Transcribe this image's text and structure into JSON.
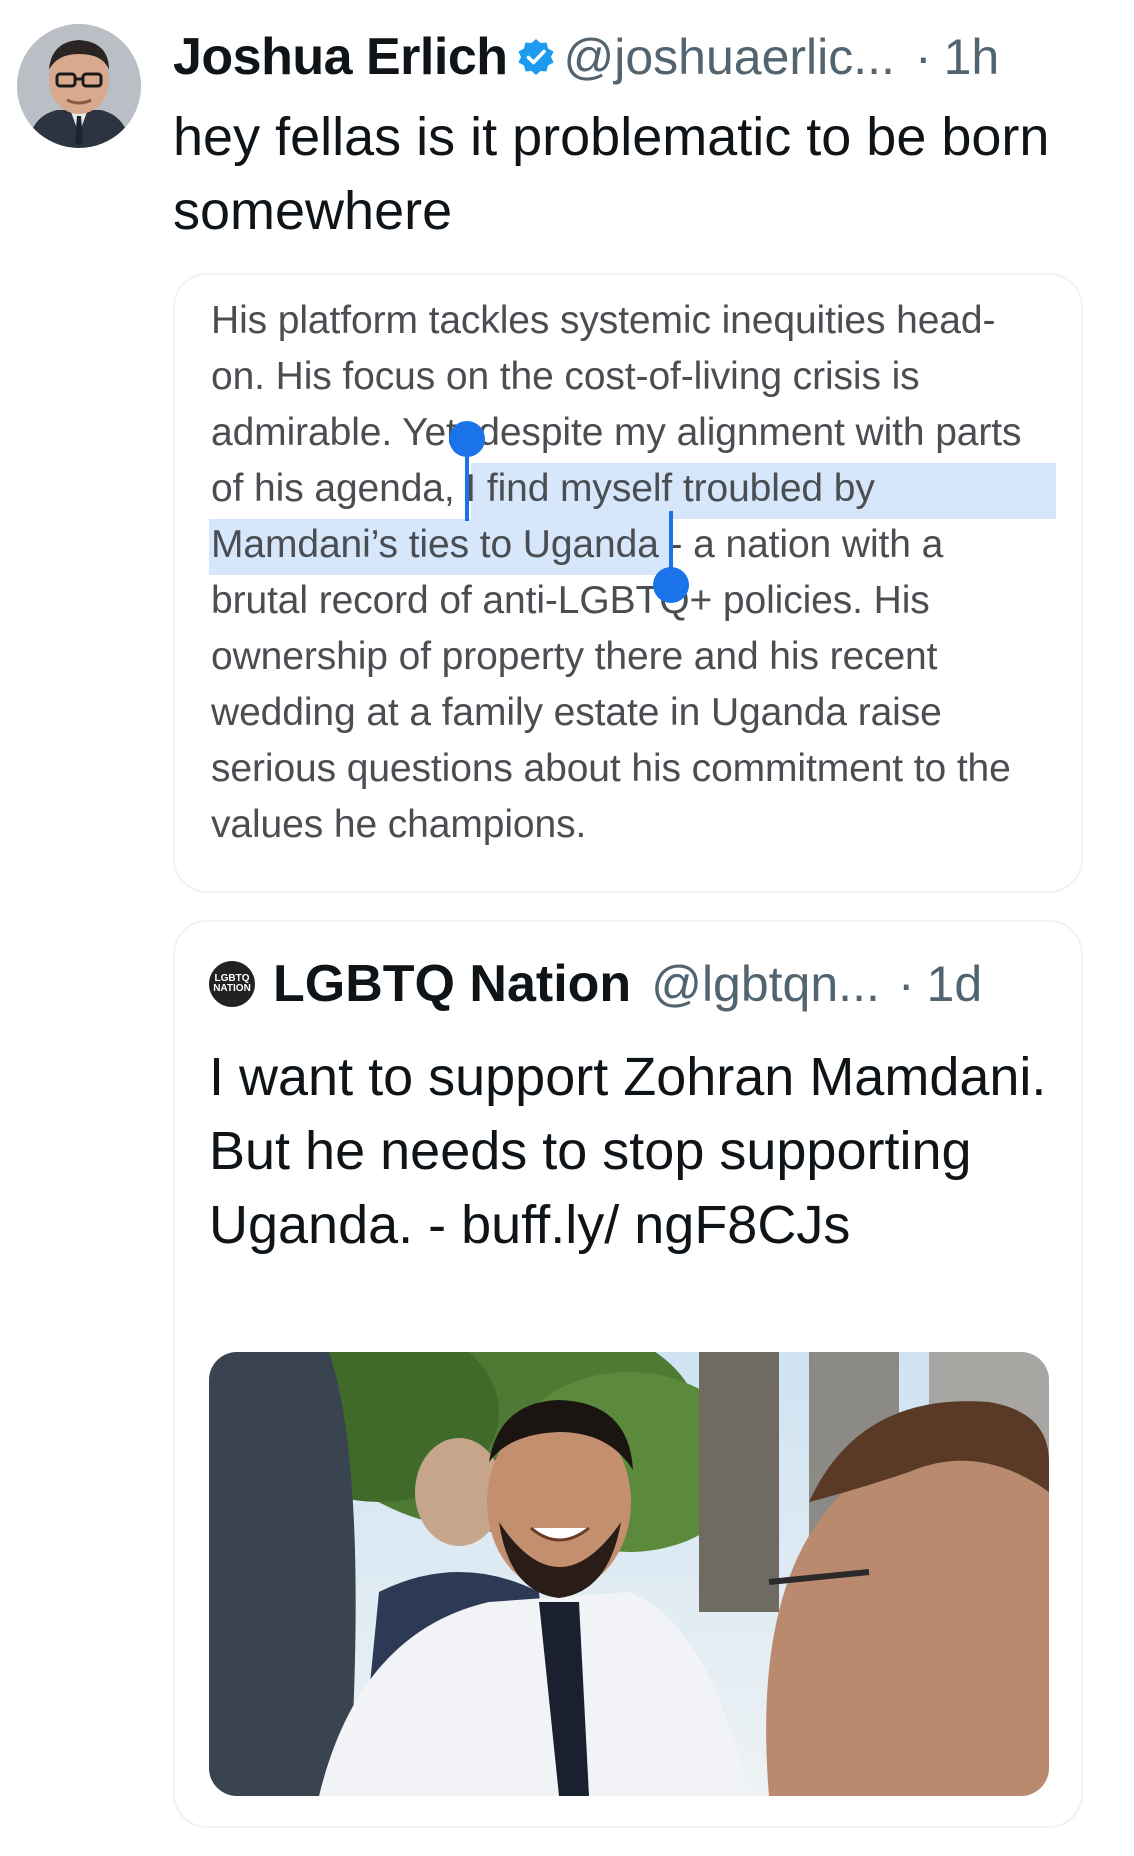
{
  "tweet": {
    "author_name": "Joshua Erlich",
    "author_handle": "@joshuaerlic...",
    "separator": "·",
    "timestamp": "1h",
    "verified_icon": "verified-badge-icon",
    "text": "hey fellas is it problematic to be born somewhere"
  },
  "screenshot_card": {
    "line1": "His platform tackles systemic inequities head-",
    "line2": "on. His focus on the cost-of-living crisis is",
    "line3": "admirable. Yet, despite my alignment with parts",
    "line4": "of his agenda, I find myself troubled by",
    "line5": "Mamdani’s ties to Uganda - a nation with a",
    "line6": "brutal record of anti-LGBTQ+ policies. His",
    "line7": "ownership of property there and his recent",
    "line8": "wedding at a family estate in Uganda raise",
    "line9": "serious questions about his commitment to the",
    "line10": "values he champions.",
    "selection_color": "#d6e6fb",
    "handle_color": "#1a73e8"
  },
  "quoted_tweet": {
    "logo_text_top": "LGBTQ",
    "logo_text_bottom": "NATION",
    "author_name": "LGBTQ Nation",
    "author_handle": "@lgbtqn...",
    "separator": "·",
    "timestamp": "1d",
    "text": "I want to support Zohran Mamdani. But he needs to stop supporting Uganda. - buff.ly/ ngF8CJs",
    "media": "photo"
  },
  "colors": {
    "text_primary": "#0f1419",
    "text_secondary": "#536471",
    "verified_blue": "#1d9bf0",
    "card_border": "#eff3f4"
  }
}
